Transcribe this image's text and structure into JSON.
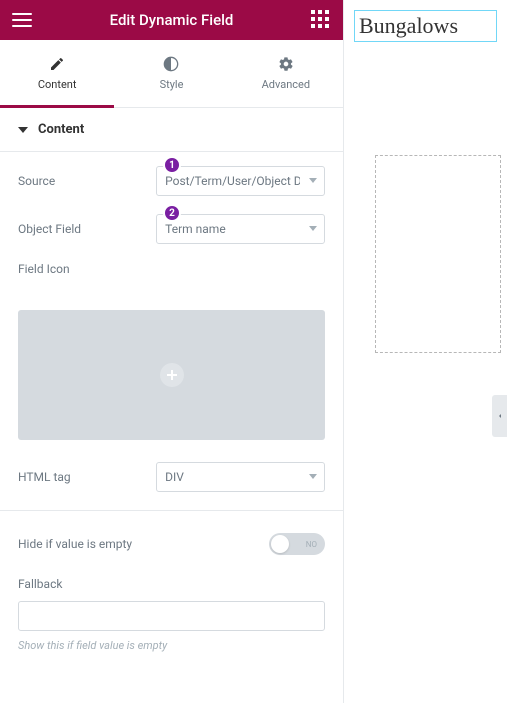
{
  "header": {
    "title": "Edit Dynamic Field"
  },
  "tabs": {
    "content": "Content",
    "style": "Style",
    "advanced": "Advanced"
  },
  "section": {
    "title": "Content"
  },
  "badges": {
    "one": "1",
    "two": "2"
  },
  "fields": {
    "source": {
      "label": "Source",
      "value": "Post/Term/User/Object Data"
    },
    "object_field": {
      "label": "Object Field",
      "value": "Term name"
    },
    "field_icon": {
      "label": "Field Icon"
    },
    "html_tag": {
      "label": "HTML tag",
      "value": "DIV"
    },
    "hide_empty": {
      "label": "Hide if value is empty",
      "state_text": "NO"
    },
    "fallback": {
      "label": "Fallback",
      "value": "",
      "help": "Show this if field value is empty"
    }
  },
  "preview": {
    "heading": "Bungalows"
  }
}
